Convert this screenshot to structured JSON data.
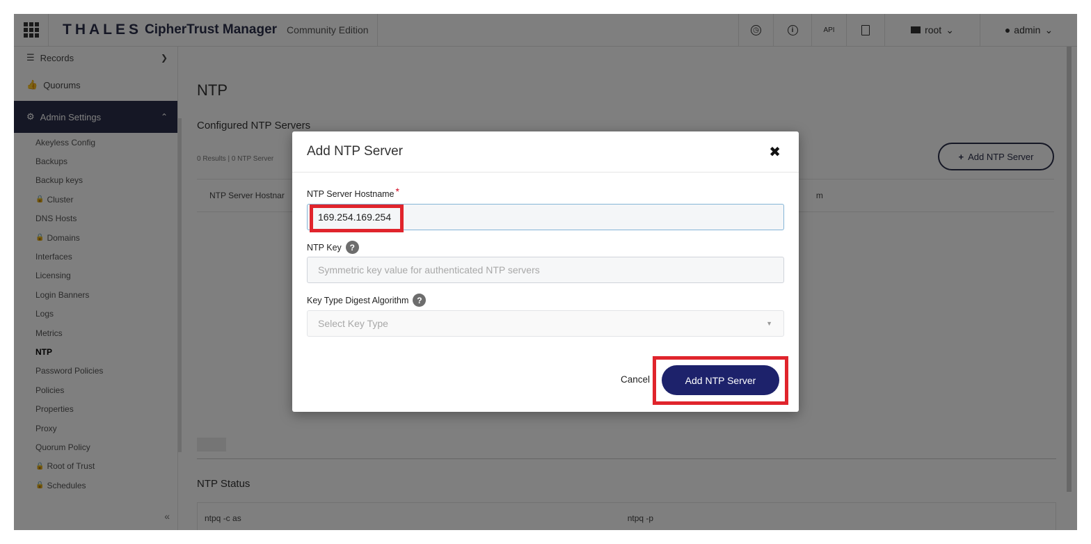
{
  "topbar": {
    "brand": "THALES",
    "product": "CipherTrust Manager",
    "edition": "Community Edition",
    "api_label": "API",
    "domain_label": "root",
    "user_label": "admin"
  },
  "sidebar": {
    "records": "Records",
    "quorums": "Quorums",
    "admin_settings": "Admin Settings",
    "items": [
      {
        "label": "Akeyless Config",
        "locked": false
      },
      {
        "label": "Backups",
        "locked": false
      },
      {
        "label": "Backup keys",
        "locked": false
      },
      {
        "label": "Cluster",
        "locked": true
      },
      {
        "label": "DNS Hosts",
        "locked": false
      },
      {
        "label": "Domains",
        "locked": true
      },
      {
        "label": "Interfaces",
        "locked": false
      },
      {
        "label": "Licensing",
        "locked": false
      },
      {
        "label": "Login Banners",
        "locked": false
      },
      {
        "label": "Logs",
        "locked": false
      },
      {
        "label": "Metrics",
        "locked": false
      },
      {
        "label": "NTP",
        "locked": false
      },
      {
        "label": "Password Policies",
        "locked": false
      },
      {
        "label": "Policies",
        "locked": false
      },
      {
        "label": "Properties",
        "locked": false
      },
      {
        "label": "Proxy",
        "locked": false
      },
      {
        "label": "Quorum Policy",
        "locked": false
      },
      {
        "label": "Root of Trust",
        "locked": true
      },
      {
        "label": "Schedules",
        "locked": true
      }
    ],
    "collapse": "«"
  },
  "main": {
    "title": "NTP",
    "section": "Configured NTP Servers",
    "results": "0 Results | 0 NTP Server",
    "add_button": "Add NTP Server",
    "table_col1": "NTP Server Hostnar",
    "table_col2": "m",
    "status_title": "NTP Status",
    "status_col1": "ntpq -c as",
    "status_col2": "ntpq -p"
  },
  "modal": {
    "title": "Add NTP Server",
    "hostname_label": "NTP Server Hostname",
    "hostname_value": "169.254.169.254",
    "key_label": "NTP Key",
    "key_placeholder": "Symmetric key value for authenticated NTP servers",
    "algo_label": "Key Type Digest Algorithm",
    "algo_placeholder": "Select Key Type",
    "cancel": "Cancel",
    "submit": "Add NTP Server"
  }
}
